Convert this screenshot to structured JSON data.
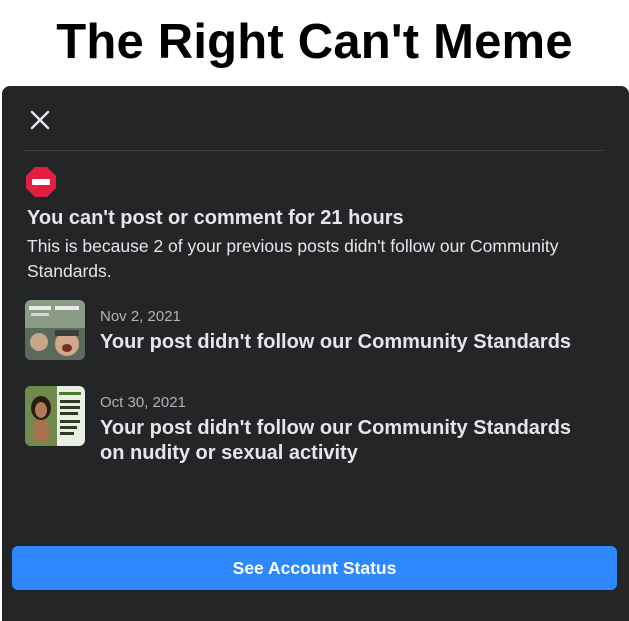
{
  "meme": {
    "caption": "The Right Can't Meme"
  },
  "dialog": {
    "close_icon": "close-icon",
    "status_icon": "no-entry-icon",
    "headline": "You can't post or comment for 21 hours",
    "description": "This is because 2 of your previous posts didn't follow our Community Standards.",
    "posts": [
      {
        "date": "Nov 2, 2021",
        "title": "Your post didn't follow our Community Standards",
        "thumbnail_icon": "post-thumbnail-image"
      },
      {
        "date": "Oct 30, 2021",
        "title": "Your post didn't follow our Community Standards on nudity or sexual activity",
        "thumbnail_icon": "post-thumbnail-image"
      }
    ],
    "primary_button": "See Account Status"
  },
  "colors": {
    "dialog_background": "#242526",
    "text_primary": "#e4e6eb",
    "text_secondary": "#b0b3b8",
    "divider": "#3e4042",
    "button_blue": "#2d88ff",
    "warning_red": "#e41e3f"
  }
}
